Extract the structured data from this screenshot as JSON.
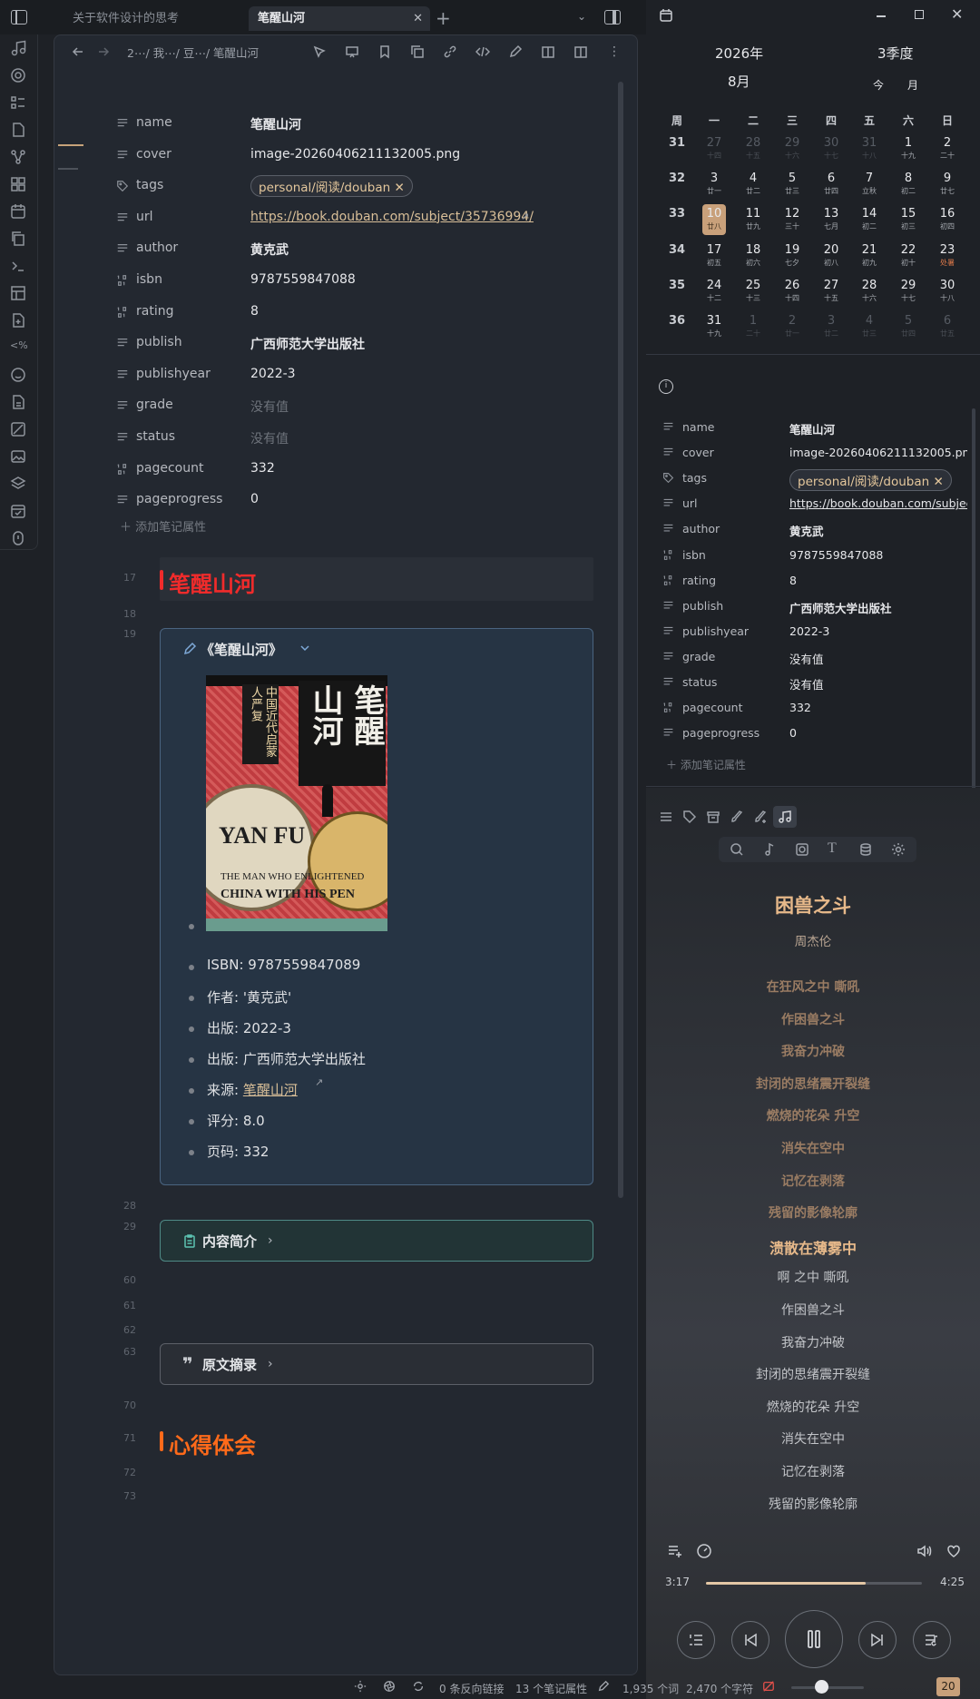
{
  "tabs": [
    {
      "label": "关于软件设计的思考"
    },
    {
      "label": "笔醒山河"
    }
  ],
  "breadcrumb": {
    "text": "2⋯/ 我⋯/ 豆⋯/ 笔醒山河"
  },
  "properties": [
    {
      "icon": "text-icon",
      "key": "name",
      "value": "笔醒山河",
      "style": "bold"
    },
    {
      "icon": "text-icon",
      "key": "cover",
      "value": "image-20260406211132005.png",
      "style": "plain"
    },
    {
      "icon": "tag-icon",
      "key": "tags",
      "value": "personal/阅读/douban",
      "style": "tag"
    },
    {
      "icon": "text-icon",
      "key": "url",
      "value": "https://book.douban.com/subject/35736994/",
      "style": "link"
    },
    {
      "icon": "text-icon",
      "key": "author",
      "value": "黄克武",
      "style": "bold"
    },
    {
      "icon": "number-icon",
      "key": "isbn",
      "value": "9787559847088",
      "style": "plain"
    },
    {
      "icon": "number-icon",
      "key": "rating",
      "value": "8",
      "style": "plain"
    },
    {
      "icon": "text-icon",
      "key": "publish",
      "value": "广西师范大学出版社",
      "style": "bold"
    },
    {
      "icon": "text-icon",
      "key": "publishyear",
      "value": "2022-3",
      "style": "plain"
    },
    {
      "icon": "text-icon",
      "key": "grade",
      "value": "没有值",
      "style": "empty"
    },
    {
      "icon": "text-icon",
      "key": "status",
      "value": "没有值",
      "style": "empty"
    },
    {
      "icon": "number-icon",
      "key": "pagecount",
      "value": "332",
      "style": "plain"
    },
    {
      "icon": "text-icon",
      "key": "pageprogress",
      "value": "0",
      "style": "plain"
    }
  ],
  "add_property": "添加笔记属性",
  "line_numbers": {
    "l17": "17",
    "l18": "18",
    "l19": "19",
    "l28": "28",
    "l29": "29",
    "l60": "60",
    "l61": "61",
    "l62": "62",
    "l63": "63",
    "l70": "70",
    "l71": "71",
    "l72": "72",
    "l73": "73"
  },
  "heading1": "笔醒山河",
  "callout": {
    "title": "《笔醒山河》",
    "items": [
      "ISBN: 9787559847089",
      "作者: '黄克武'",
      "出版: 2022-3",
      "出版: 广西师范大学出版社",
      "来源: 笔醒山河",
      "评分:  8.0",
      "页码: 332"
    ]
  },
  "cover": {
    "title_main": "笔醒",
    "title_sub": "山河",
    "vertical": "中国近代启蒙人严复",
    "en1": "YAN FU",
    "en2": "THE MAN WHO ENLIGHTENED",
    "en3": "CHINA WITH HIS PEN"
  },
  "fold1": "内容简介",
  "fold2": "原文摘录",
  "heading2": "心得体会",
  "calendar": {
    "year": "2026年",
    "month": "8月",
    "quarter": "3季度",
    "btn_today": "今",
    "btn_month": "月",
    "weekdays": [
      "周",
      "一",
      "二",
      "三",
      "四",
      "五",
      "六",
      "日"
    ],
    "weeks": [
      {
        "wk": "31",
        "days": [
          [
            "27",
            "十四",
            1
          ],
          [
            "28",
            "十五",
            1
          ],
          [
            "29",
            "十六",
            1
          ],
          [
            "30",
            "十七",
            1
          ],
          [
            "31",
            "十八",
            1
          ],
          [
            "1",
            "十九",
            0
          ],
          [
            "2",
            "二十",
            0
          ]
        ]
      },
      {
        "wk": "32",
        "days": [
          [
            "3",
            "廿一",
            0
          ],
          [
            "4",
            "廿二",
            0
          ],
          [
            "5",
            "廿三",
            0
          ],
          [
            "6",
            "廿四",
            0
          ],
          [
            "7",
            "立秋",
            0
          ],
          [
            "8",
            "初二",
            0
          ],
          [
            "9",
            "廿七",
            0
          ]
        ]
      },
      {
        "wk": "33",
        "days": [
          [
            "10",
            "廿八",
            0
          ],
          [
            "11",
            "廿九",
            0
          ],
          [
            "12",
            "三十",
            0
          ],
          [
            "13",
            "七月",
            0
          ],
          [
            "14",
            "初二",
            0
          ],
          [
            "15",
            "初三",
            0
          ],
          [
            "16",
            "初四",
            0
          ]
        ]
      },
      {
        "wk": "34",
        "days": [
          [
            "17",
            "初五",
            0
          ],
          [
            "18",
            "初六",
            0
          ],
          [
            "19",
            "七夕",
            0
          ],
          [
            "20",
            "初八",
            0
          ],
          [
            "21",
            "初九",
            0
          ],
          [
            "22",
            "初十",
            0
          ],
          [
            "23",
            "处暑",
            0
          ]
        ]
      },
      {
        "wk": "35",
        "days": [
          [
            "24",
            "十二",
            0
          ],
          [
            "25",
            "十三",
            0
          ],
          [
            "26",
            "十四",
            0
          ],
          [
            "27",
            "十五",
            0
          ],
          [
            "28",
            "十六",
            0
          ],
          [
            "29",
            "十七",
            0
          ],
          [
            "30",
            "十八",
            0
          ]
        ]
      },
      {
        "wk": "36",
        "days": [
          [
            "31",
            "十九",
            0
          ],
          [
            "1",
            "二十",
            1
          ],
          [
            "2",
            "廿一",
            1
          ],
          [
            "3",
            "廿二",
            1
          ],
          [
            "4",
            "廿三",
            1
          ],
          [
            "5",
            "廿四",
            1
          ],
          [
            "6",
            "廿五",
            1
          ]
        ]
      }
    ]
  },
  "right_properties": [
    {
      "icon": "text-icon",
      "key": "name",
      "value": "笔醒山河",
      "style": "bold"
    },
    {
      "icon": "text-icon",
      "key": "cover",
      "value": "image-20260406211132005.png",
      "style": "plain"
    },
    {
      "icon": "tag-icon",
      "key": "tags",
      "value": "personal/阅读/douban",
      "style": "tag"
    },
    {
      "icon": "text-icon",
      "key": "url",
      "value": "https://book.douban.com/subject/35736994/",
      "style": "link"
    },
    {
      "icon": "text-icon",
      "key": "author",
      "value": "黄克武",
      "style": "bold"
    },
    {
      "icon": "number-icon",
      "key": "isbn",
      "value": "9787559847088",
      "style": "plain"
    },
    {
      "icon": "number-icon",
      "key": "rating",
      "value": "8",
      "style": "plain"
    },
    {
      "icon": "text-icon",
      "key": "publish",
      "value": "广西师范大学出版社",
      "style": "bold"
    },
    {
      "icon": "text-icon",
      "key": "publishyear",
      "value": "2022-3",
      "style": "plain"
    },
    {
      "icon": "text-icon",
      "key": "grade",
      "value": "没有值",
      "style": "empty"
    },
    {
      "icon": "text-icon",
      "key": "status",
      "value": "没有值",
      "style": "empty"
    },
    {
      "icon": "number-icon",
      "key": "pagecount",
      "value": "332",
      "style": "plain"
    },
    {
      "icon": "text-icon",
      "key": "pageprogress",
      "value": "0",
      "style": "plain"
    }
  ],
  "music": {
    "title": "困兽之斗",
    "artist": "周杰伦",
    "lyrics": [
      {
        "t": "在狂风之中 嘶吼",
        "s": "past"
      },
      {
        "t": "作困兽之斗",
        "s": "past"
      },
      {
        "t": "我奋力冲破",
        "s": "past"
      },
      {
        "t": "封闭的思绪震开裂缝",
        "s": "past"
      },
      {
        "t": "燃烧的花朵 升空",
        "s": "past"
      },
      {
        "t": "消失在空中",
        "s": "past"
      },
      {
        "t": "记忆在剥落",
        "s": "past"
      },
      {
        "t": "残留的影像轮廓",
        "s": "past"
      },
      {
        "t": "溃散在薄雾中",
        "s": "cur"
      },
      {
        "t": "啊 之中 嘶吼",
        "s": "fut"
      },
      {
        "t": "作困兽之斗",
        "s": "fut"
      },
      {
        "t": "我奋力冲破",
        "s": "fut"
      },
      {
        "t": "封闭的思绪震开裂缝",
        "s": "fut"
      },
      {
        "t": "燃烧的花朵 升空",
        "s": "fut"
      },
      {
        "t": "消失在空中",
        "s": "fut"
      },
      {
        "t": "记忆在剥落",
        "s": "fut"
      },
      {
        "t": "残留的影像轮廓",
        "s": "fut"
      }
    ],
    "elapsed": "3:17",
    "duration": "4:25",
    "progress": 0.74
  },
  "status": {
    "backlinks": "0 条反向链接",
    "props": "13 个笔记属性",
    "words": "1,935 个词",
    "chars": "2,470 个字符",
    "badge": "20"
  },
  "colors": {
    "accent": "#d9bf98",
    "heading": "#f02b2b",
    "heading2": "#ff6a1a",
    "callout_border": "#4a6480"
  }
}
